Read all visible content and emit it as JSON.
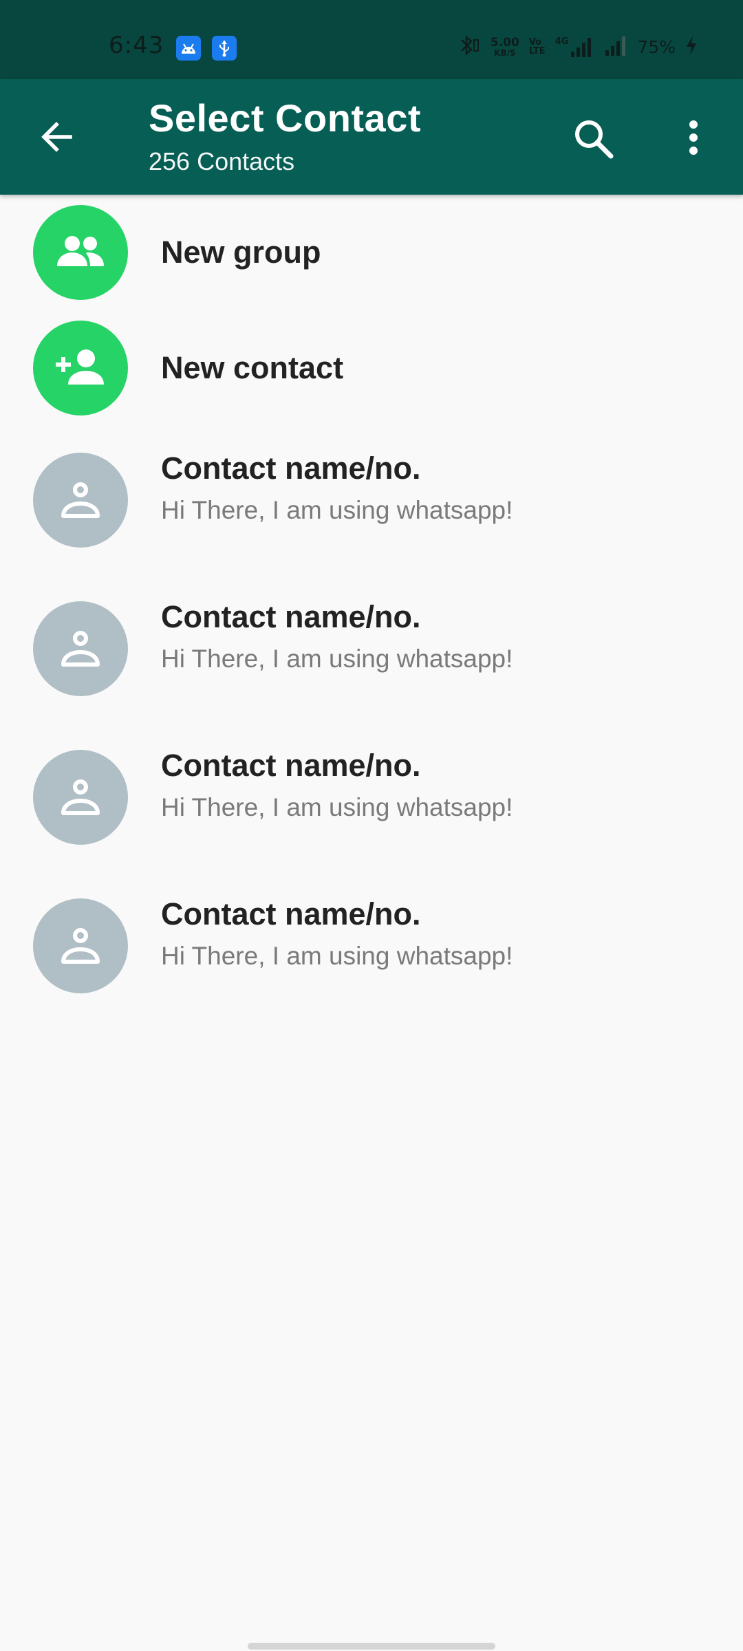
{
  "status_bar": {
    "time": "6:43",
    "network_speed_value": "5.00",
    "network_speed_unit": "KB/S",
    "volte_top": "Vo",
    "volte_bottom": "LTE",
    "network_type": "4G",
    "battery": "75%"
  },
  "header": {
    "title": "Select Contact",
    "subtitle": "256 Contacts"
  },
  "actions": [
    {
      "label": "New group",
      "icon": "group-icon"
    },
    {
      "label": "New contact",
      "icon": "add-person-icon"
    }
  ],
  "contacts": [
    {
      "name": "Contact name/no.",
      "status": "Hi There, I am using whatsapp!"
    },
    {
      "name": "Contact name/no.",
      "status": "Hi There, I am using whatsapp!"
    },
    {
      "name": "Contact name/no.",
      "status": "Hi There, I am using whatsapp!"
    },
    {
      "name": "Contact name/no.",
      "status": "Hi There, I am using whatsapp!"
    }
  ],
  "colors": {
    "status_bar": "#084740",
    "app_bar": "#075e54",
    "accent_green": "#25d366",
    "avatar_gray": "#b0bec5"
  }
}
